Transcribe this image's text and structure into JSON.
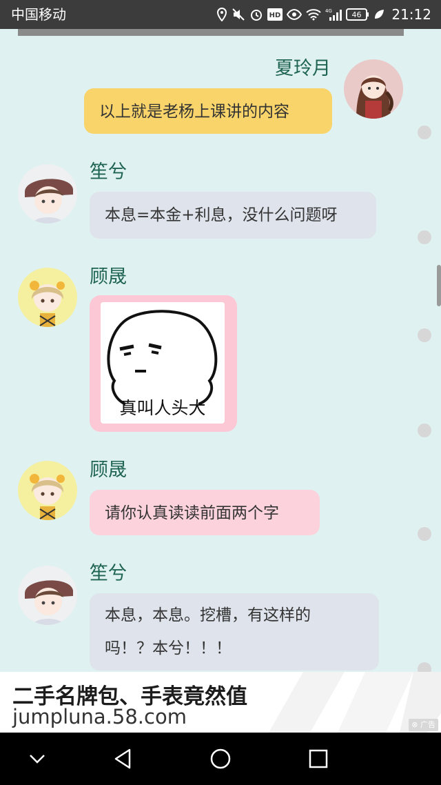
{
  "status_bar": {
    "carrier": "中国移动",
    "network_type": "4G",
    "battery": "46",
    "time": "21:12",
    "icons": [
      "location-icon",
      "mute-icon",
      "alarm-icon",
      "hd-icon",
      "eye-icon",
      "wifi-icon",
      "signal-icon",
      "battery-icon",
      "leaf-icon"
    ]
  },
  "chat": {
    "messages": [
      {
        "sender": "夏玲月",
        "side": "right",
        "type": "text",
        "bubble_color": "#f9d46a",
        "text": "以上就是老杨上课讲的内容"
      },
      {
        "sender": "笙兮",
        "side": "left",
        "type": "text",
        "bubble_color": "#dfe4ec",
        "text": "本息=本金+利息，没什么问题呀"
      },
      {
        "sender": "顾晟",
        "side": "left",
        "type": "sticker",
        "bubble_color": "#fcc8d6",
        "sticker_caption": "真叫人头大"
      },
      {
        "sender": "顾晟",
        "side": "left",
        "type": "text",
        "bubble_color": "#fcd3dd",
        "text": "请你认真读读前面两个字"
      },
      {
        "sender": "笙兮",
        "side": "left",
        "type": "text",
        "bubble_color": "#dfe4ec",
        "lines": [
          "本息，本息。挖槽，有这样的",
          "吗！？本兮！！！"
        ]
      }
    ]
  },
  "ad": {
    "title": "二手名牌包、手表竟然值",
    "url": "jumpluna.58.com",
    "badge": "广告"
  },
  "nav": {
    "buttons": [
      "chevron-down-icon",
      "back-icon",
      "home-icon",
      "recents-icon"
    ]
  }
}
